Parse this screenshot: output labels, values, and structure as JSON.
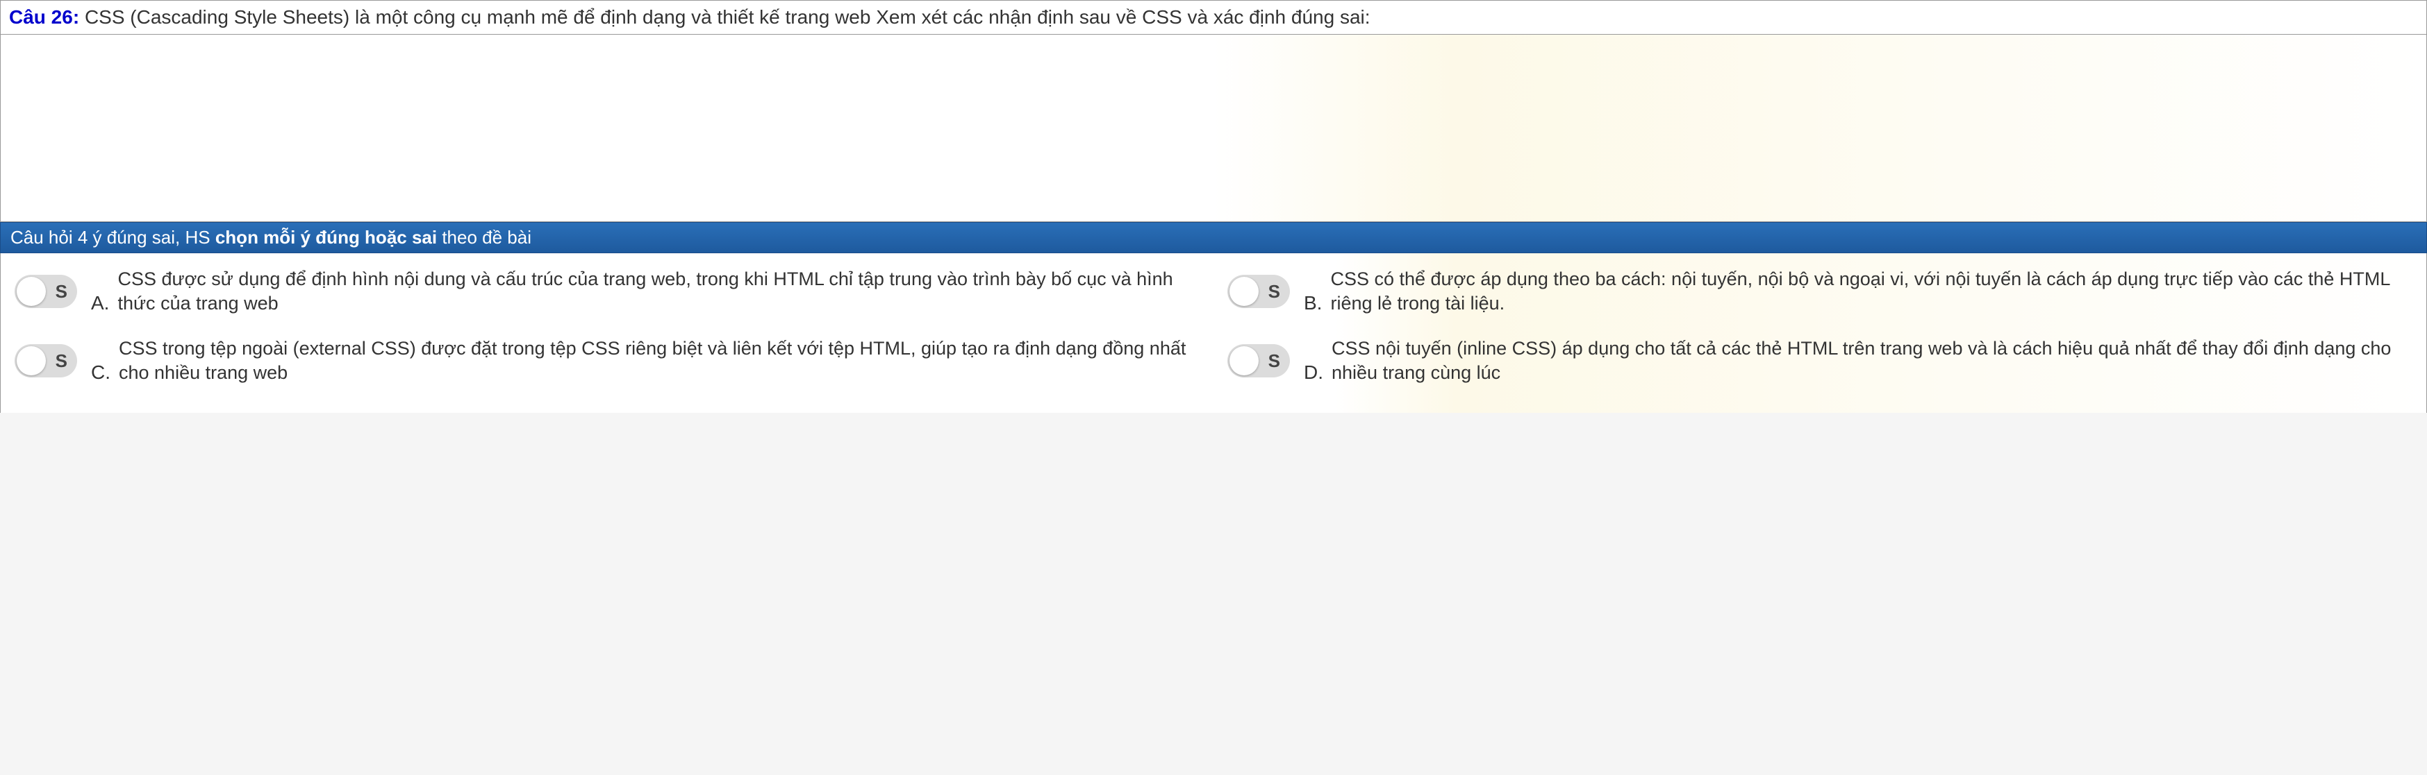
{
  "question": {
    "number_label": "Câu 26:",
    "text": "CSS (Cascading Style Sheets) là một công cụ mạnh mẽ để định dạng và thiết kế trang web Xem xét các nhận định sau về CSS và xác định đúng sai:"
  },
  "instruction": {
    "prefix": "Câu hỏi 4 ý đúng sai, HS ",
    "highlight": "chọn mỗi ý đúng hoặc sai",
    "suffix": " theo đề bài"
  },
  "toggle_label": "S",
  "answers": {
    "a": {
      "letter": "A.",
      "text": "CSS được sử dụng để định hình nội dung và cấu trúc của trang web, trong khi HTML chỉ tập trung vào trình bày bố cục và hình thức của trang web"
    },
    "b": {
      "letter": "B.",
      "text": "CSS có thể được áp dụng theo ba cách: nội tuyến, nội bộ và ngoại vi, với nội tuyến là cách áp dụng trực tiếp vào các thẻ HTML riêng lẻ trong tài liệu."
    },
    "c": {
      "letter": "C.",
      "text": "CSS trong tệp ngoài (external CSS) được đặt trong tệp CSS riêng biệt và liên kết với tệp HTML, giúp tạo ra định dạng đồng nhất cho nhiều trang web"
    },
    "d": {
      "letter": "D.",
      "text": "CSS nội tuyến (inline CSS) áp dụng cho tất cả các thẻ HTML trên trang web và là cách hiệu quả nhất để thay đổi định dạng cho nhiều trang cùng lúc"
    }
  }
}
